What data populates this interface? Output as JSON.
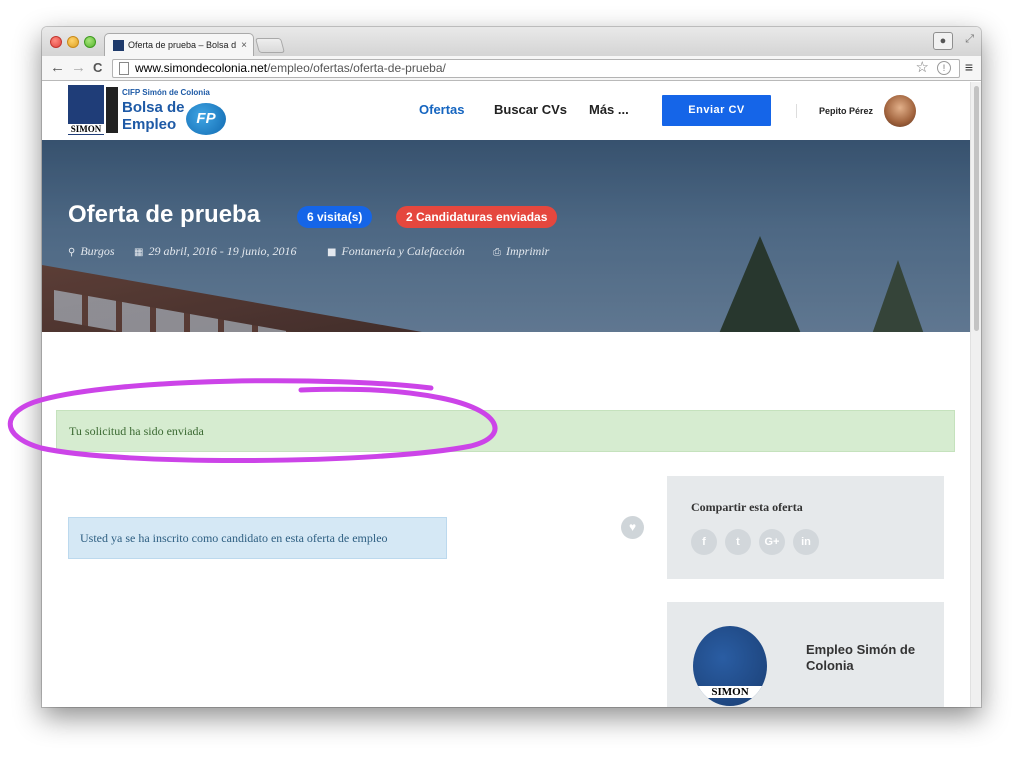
{
  "browser": {
    "tab_title": "Oferta de prueba – Bolsa d",
    "tab_close": "×",
    "url_host": "www.simondecolonia.net",
    "url_path": "/empleo/ofertas/oferta-de-prueba/",
    "back": "←",
    "forward": "→",
    "reload": "C",
    "star": "☆",
    "menu": "≡",
    "ext": "!"
  },
  "header": {
    "logo_school": "CIFP Simón de Colonia",
    "logo_line1": "Bolsa de",
    "logo_line2": "Empleo",
    "logo_badge": "FP",
    "logo_mark_text": "SIMON",
    "nav": {
      "ofertas": "Ofertas",
      "buscar": "Buscar CVs",
      "mas": "Más ..."
    },
    "cta": "Enviar CV",
    "user_name": "Pepito Pérez"
  },
  "hero": {
    "title": "Oferta de prueba",
    "visits": "6 visita(s)",
    "applications": "2 Candidaturas enviadas",
    "location": "Burgos",
    "dates": "29 abril, 2016 - 19 junio, 2016",
    "category": "Fontanería y Calefacción",
    "print": "Imprimir"
  },
  "alerts": {
    "success": "Tu solicitud ha sido enviada",
    "info": "Usted ya se ha inscrito como candidato en esta oferta de empleo"
  },
  "sidebar": {
    "share_title": "Compartir esta oferta",
    "share_icons": [
      "f",
      "t",
      "G+",
      "in"
    ],
    "company_name": "Empleo Simón de Colonia",
    "company_logo_text": "SIMON"
  },
  "colors": {
    "accent_blue": "#1565e8",
    "badge_red": "#e5473e",
    "success_bg": "#d6ecd0",
    "info_bg": "#d5e8f5",
    "annotation": "#cc44e8"
  }
}
